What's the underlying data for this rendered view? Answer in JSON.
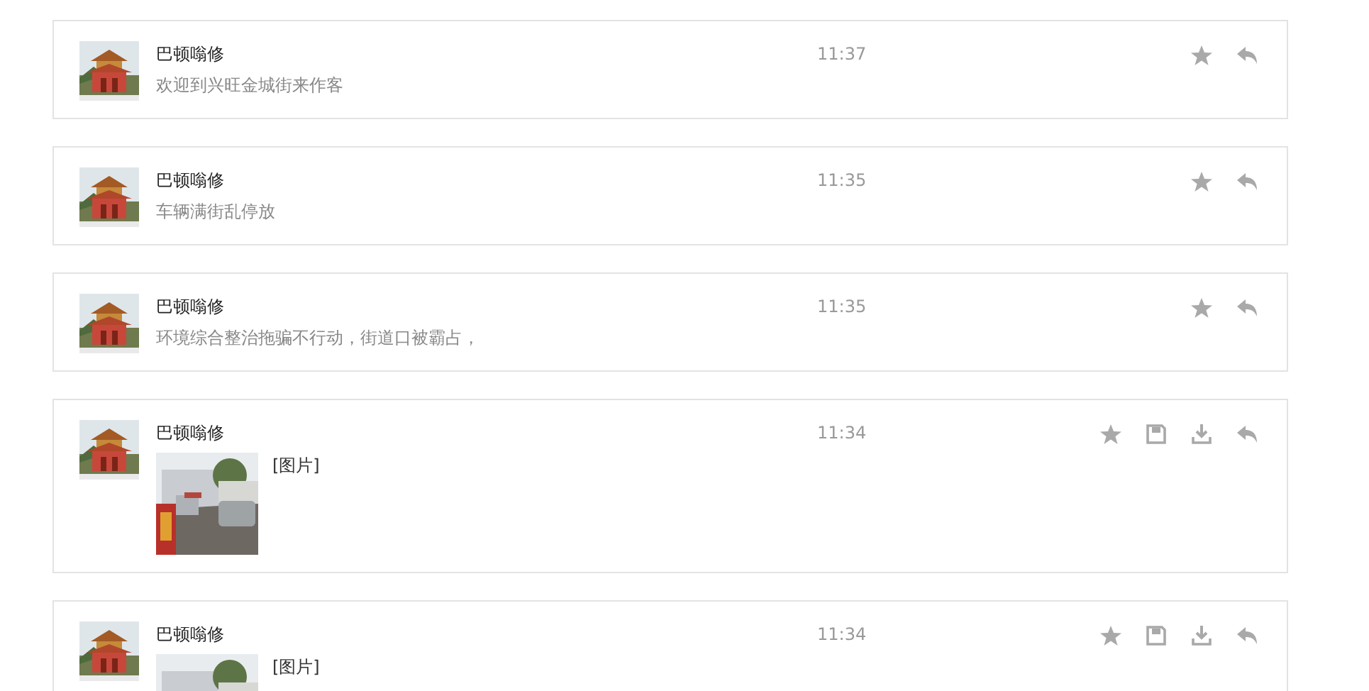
{
  "messages": [
    {
      "kind": "text",
      "sender": "巴顿嗡修",
      "time": "11:37",
      "text": "欢迎到兴旺金城街来作客",
      "actions": [
        {
          "kind": "star"
        },
        {
          "kind": "reply"
        }
      ]
    },
    {
      "kind": "text",
      "sender": "巴顿嗡修",
      "time": "11:35",
      "text": "车辆满街乱停放",
      "actions": [
        {
          "kind": "star"
        },
        {
          "kind": "reply"
        }
      ]
    },
    {
      "kind": "text",
      "sender": "巴顿嗡修",
      "time": "11:35",
      "text": "环境综合整治拖骗不行动，街道口被霸占，",
      "actions": [
        {
          "kind": "star"
        },
        {
          "kind": "reply"
        }
      ]
    },
    {
      "sender": "巴顿嗡修",
      "time": "11:34",
      "text": "[图片]",
      "actions": [
        {
          "kind": "star"
        },
        {
          "kind": "save"
        },
        {
          "kind": "download"
        },
        {
          "kind": "reply"
        }
      ]
    },
    {
      "sender": "巴顿嗡修",
      "time": "11:34",
      "text": "[图片]",
      "actions": [
        {
          "kind": "star"
        },
        {
          "kind": "save"
        },
        {
          "kind": "download"
        },
        {
          "kind": "reply"
        }
      ]
    }
  ]
}
